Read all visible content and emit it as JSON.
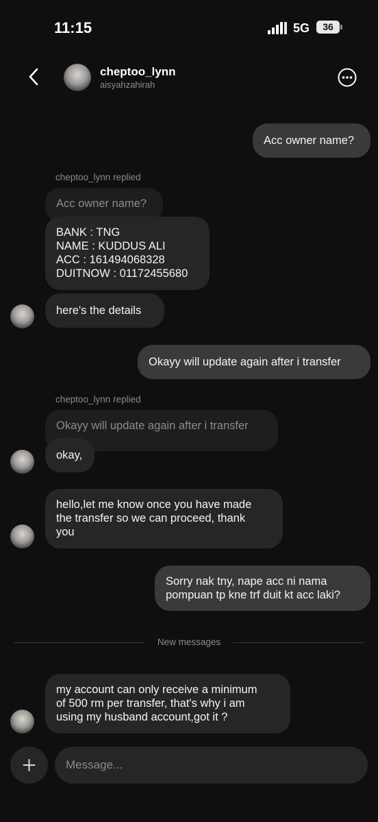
{
  "status_bar": {
    "time": "11:15",
    "network": "5G",
    "battery": "36"
  },
  "header": {
    "name": "cheptoo_lynn",
    "username": "aisyahzahirah",
    "back_icon": "chevron-left-icon",
    "more_icon": "more-circle-icon"
  },
  "messages": {
    "m1": "Acc owner name?",
    "reply1_label": "cheptoo_lynn replied",
    "reply1_quote": "Acc owner name?",
    "m2_line1": "BANK : TNG",
    "m2_line2": "NAME : KUDDUS ALI",
    "m2_line3": "ACC : 161494068328",
    "m2_line4": "DUITNOW : 01172455680",
    "m3": "here's the  details",
    "m4": "Okayy will update again after i transfer",
    "reply2_label": "cheptoo_lynn replied",
    "reply2_quote": "Okayy will update again after i transfer",
    "m5": "okay,",
    "m6_line1": "hello,let me know once you have made",
    "m6_line2": "the transfer so we can proceed, thank",
    "m6_line3": "you",
    "m7_line1": "Sorry nak tny, nape acc ni nama",
    "m7_line2": "pompuan tp kne trf duit kt acc laki?",
    "new_messages_label": "New messages",
    "m8_line1": "my account can only receive a minimum",
    "m8_line2": "of 500 rm per transfer, that's why i am",
    "m8_line3": "using my husband account,got it ?"
  },
  "composer": {
    "placeholder": "Message...",
    "plus_icon": "plus-icon"
  }
}
